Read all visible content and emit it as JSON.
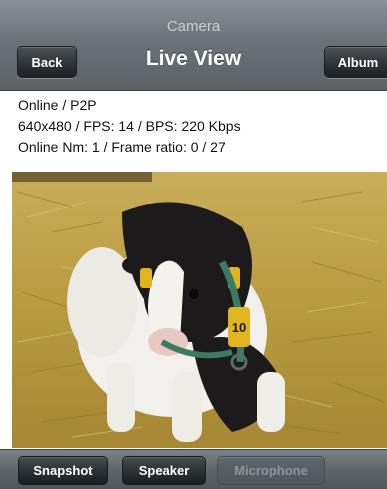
{
  "header": {
    "app_title": "Camera",
    "page_title": "Live View",
    "back_label": "Back",
    "album_label": "Album"
  },
  "status": {
    "line1": "Online / P2P",
    "line2": "640x480 / FPS: 14 / BPS: 220 Kbps",
    "line3": "Online Nm: 1 / Frame ratio: 0 / 27"
  },
  "video": {
    "tag_number": "10"
  },
  "toolbar": {
    "snapshot_label": "Snapshot",
    "speaker_label": "Speaker",
    "microphone_label": "Microphone"
  },
  "colors": {
    "navbar": "#6c7378",
    "button": "#2f3438",
    "disabled_text": "#8e9499",
    "straw": "#b89a3e",
    "ear_tag": "#e0b51e"
  }
}
